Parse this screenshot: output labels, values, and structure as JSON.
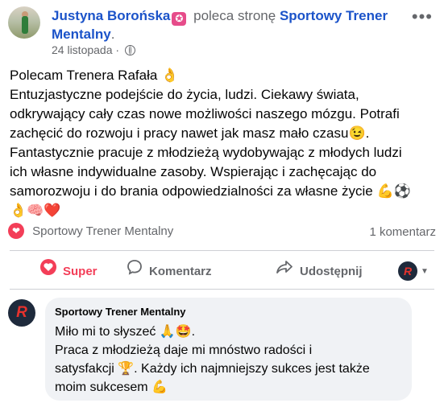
{
  "post": {
    "author": "Justyna Borońska",
    "recommends_text": "poleca stronę",
    "page_name_line1": "Sportowy Trener",
    "page_name_line2": "Mentalny",
    "date": "24 listopada",
    "body": [
      "Polecam Trenera Rafała 👌",
      "Entuzjastyczne podejście do życia, ludzi. Ciekawy świata,",
      "odkrywający cały czas  nowe możliwości naszego mózgu. Potrafi",
      "zachęcić do rozwoju i pracy nawet jak masz mało czasu😉.",
      "Fantastycznie pracuje z młodzieżą wydobywając z młodych ludzi",
      "ich własne indywidualne zasoby. Wspierając i zachęcając do",
      "samorozwoju i do brania odpowiedzialności za własne życie 💪⚽",
      "👌🧠❤️"
    ]
  },
  "reactions": {
    "name": "Sportowy Trener Mentalny",
    "comments_count": "1 komentarz"
  },
  "actions": {
    "like": "Super",
    "comment": "Komentarz",
    "share": "Udostępnij"
  },
  "comment": {
    "author": "Sportowy Trener Mentalny",
    "lines": [
      "Miło mi to słyszeć 🙏🤩.",
      "Praca z młodzieżą daje mi mnóstwo radości i",
      "satysfakcji 🏆. Każdy ich najmniejszy sukces jest także",
      "moim sukcesem 💪"
    ]
  },
  "colors": {
    "link": "#1b53c9",
    "like": "#f33e58",
    "bubble": "#f0f2f5",
    "meta": "#65676b"
  },
  "icons": [
    "avatar",
    "star-badge-icon",
    "globe-icon",
    "more-icon",
    "heart-icon",
    "comment-icon",
    "share-icon",
    "brand-logo-icon",
    "chevron-down-icon"
  ]
}
